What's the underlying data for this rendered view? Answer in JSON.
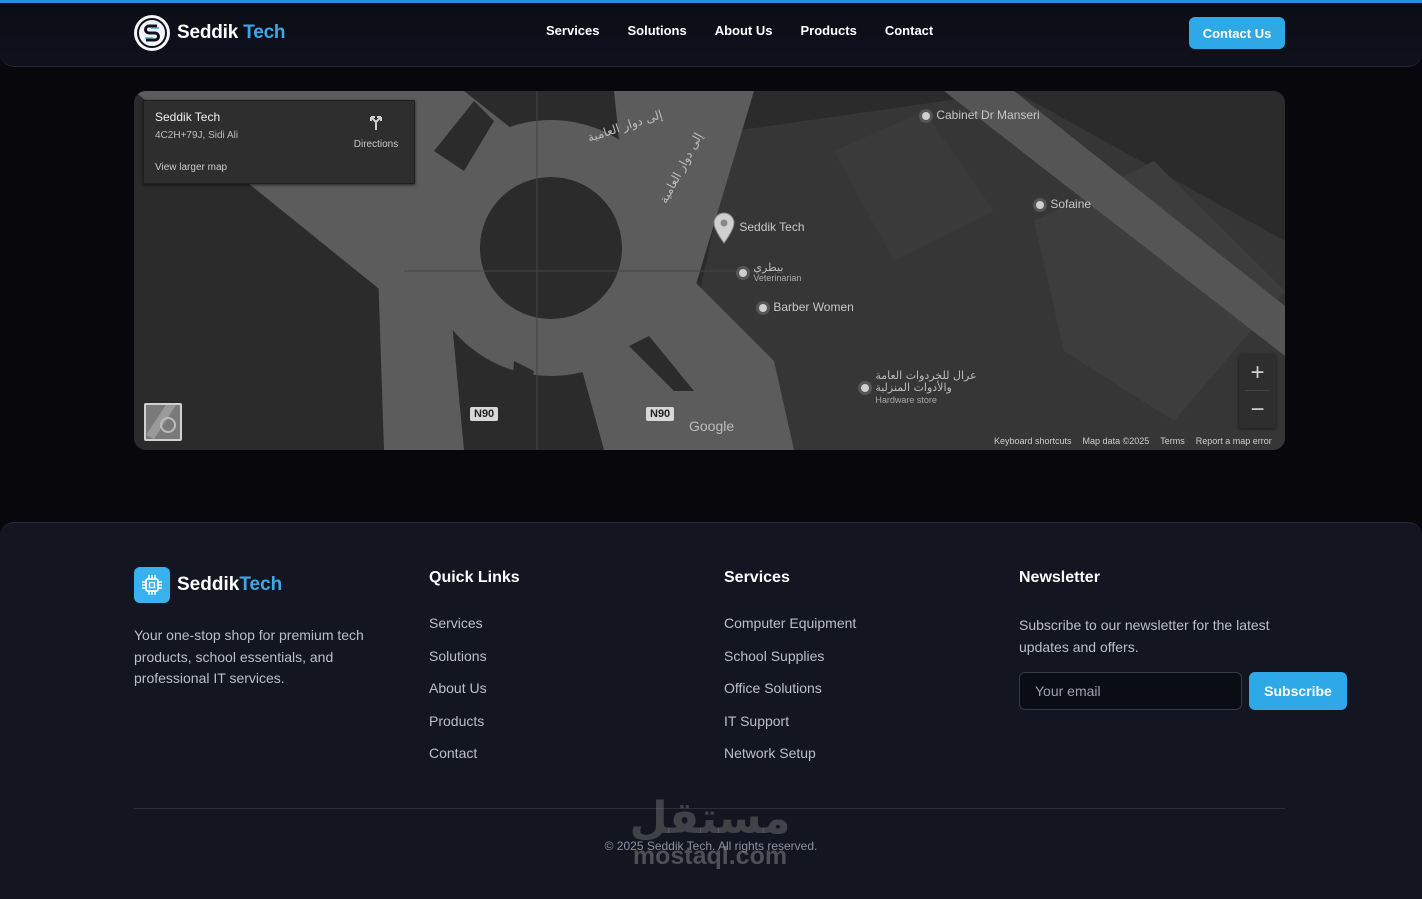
{
  "brand": {
    "name_main": "Seddik",
    "name_accent": "Tech",
    "separator": " "
  },
  "nav": {
    "items": [
      "Services",
      "Solutions",
      "About Us",
      "Products",
      "Contact"
    ],
    "cta": "Contact Us"
  },
  "map": {
    "card": {
      "title": "Seddik Tech",
      "address": "4C2H+79J, Sidi Ali",
      "larger_map": "View larger map",
      "directions": "Directions"
    },
    "places": {
      "cabinet": "Cabinet Dr Manseri",
      "sofaine": "Sofaine",
      "seddik": "Seddik Tech",
      "vet_name": "بيطري",
      "vet_type": "Veterinarian",
      "barber": "Barber Women",
      "hardware_name_1": "عرال للخردوات العامة",
      "hardware_name_2": "والأدوات المنزلية",
      "hardware_type": "Hardware store",
      "road_ar_1": "إلى دوار العامية",
      "road_ar_2": "إلى دوار العامية"
    },
    "road_badges": [
      "N90",
      "N90"
    ],
    "google": "Google",
    "footer": [
      "Keyboard shortcuts",
      "Map data ©2025",
      "Terms",
      "Report a map error"
    ],
    "zoom_in": "+",
    "zoom_out": "−"
  },
  "footer": {
    "about": "Your one-stop shop for premium tech products, school essentials, and professional IT services.",
    "quick_links": {
      "title": "Quick Links",
      "items": [
        "Services",
        "Solutions",
        "About Us",
        "Products",
        "Contact"
      ]
    },
    "services": {
      "title": "Services",
      "items": [
        "Computer Equipment",
        "School Supplies",
        "Office Solutions",
        "IT Support",
        "Network Setup"
      ]
    },
    "newsletter": {
      "title": "Newsletter",
      "text": "Subscribe to our newsletter for the latest updates and offers.",
      "placeholder": "Your email",
      "button": "Subscribe"
    },
    "copyright": "© 2025 Seddik Tech. All rights reserved."
  },
  "watermark": {
    "arabic": "مستقل",
    "latin": "mostaql.com"
  },
  "colors": {
    "accent": "#2ea8e6",
    "background": "#08080c",
    "footer_bg": "#131620"
  }
}
